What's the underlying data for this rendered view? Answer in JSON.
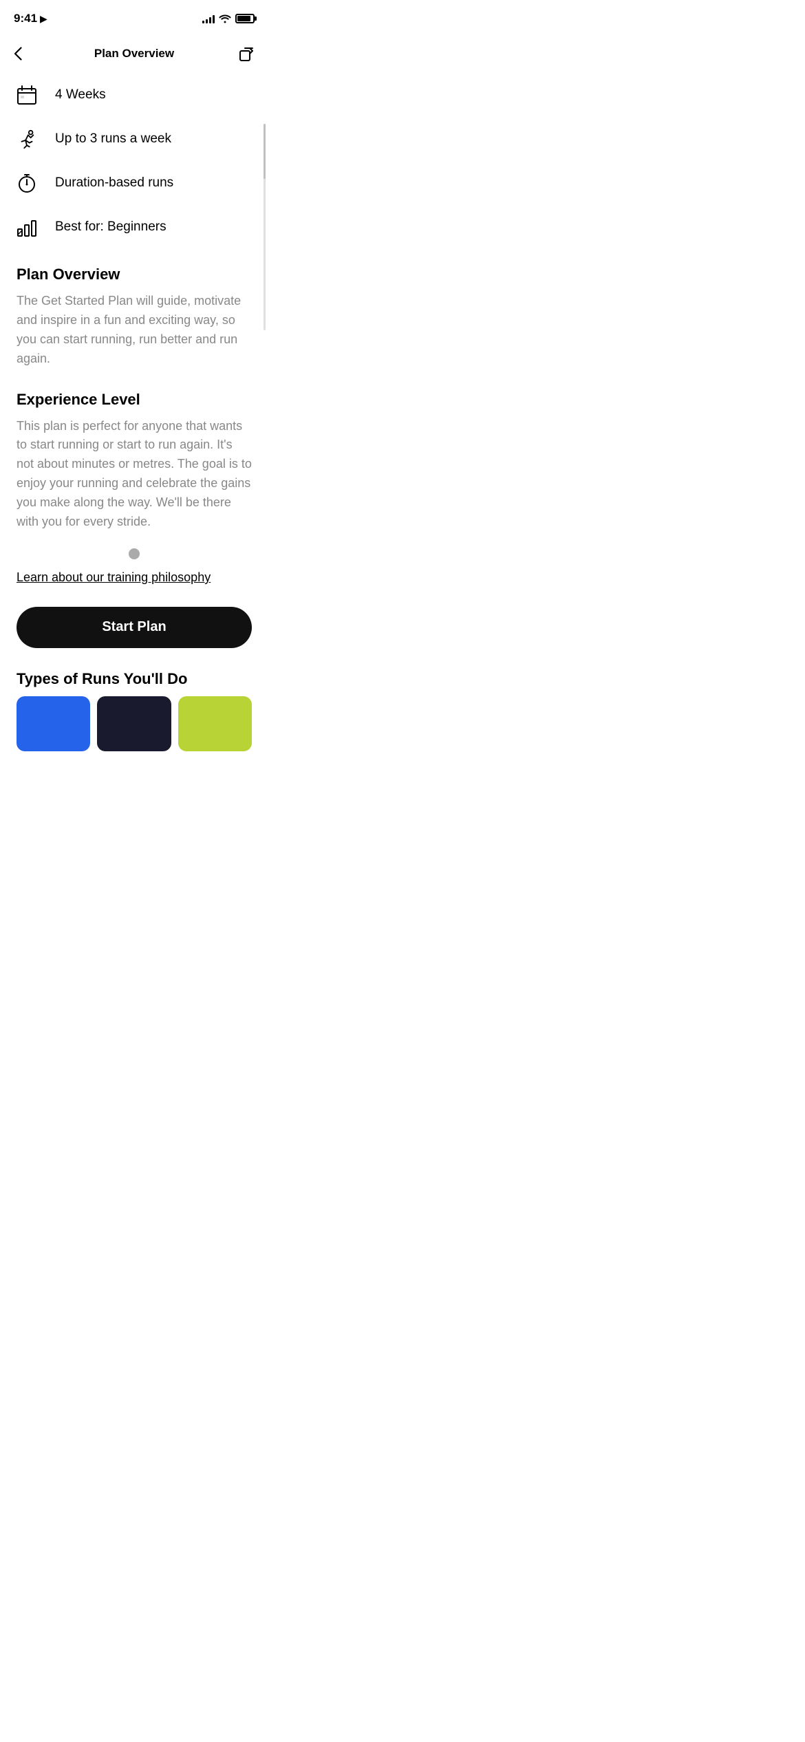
{
  "statusBar": {
    "time": "9:41",
    "hasLocation": true
  },
  "header": {
    "title": "Plan Overview",
    "backLabel": "‹",
    "shareLabel": "share"
  },
  "features": [
    {
      "id": "weeks",
      "icon": "calendar-icon",
      "text": "4 Weeks",
      "partial": true
    },
    {
      "id": "runs-per-week",
      "icon": "running-icon",
      "text": "Up to 3 runs a week"
    },
    {
      "id": "duration-based",
      "icon": "stopwatch-icon",
      "text": "Duration-based runs"
    },
    {
      "id": "best-for",
      "icon": "level-icon",
      "text": "Best for: Beginners"
    }
  ],
  "planOverview": {
    "title": "Plan Overview",
    "body": "The Get Started Plan will guide, motivate and inspire in a fun and exciting way, so you can start running, run better and run again."
  },
  "experienceLevel": {
    "title": "Experience Level",
    "body": "This plan is perfect for anyone that wants to start running or start to run again. It's not about minutes or metres. The goal is to enjoy your running and celebrate the gains you make along the way. We'll be there with you for every stride."
  },
  "trainingPhilosophyLink": "Learn about our training philosophy",
  "startPlanButton": "Start Plan",
  "typesOfRuns": {
    "title": "Types of Runs You'll Do"
  }
}
